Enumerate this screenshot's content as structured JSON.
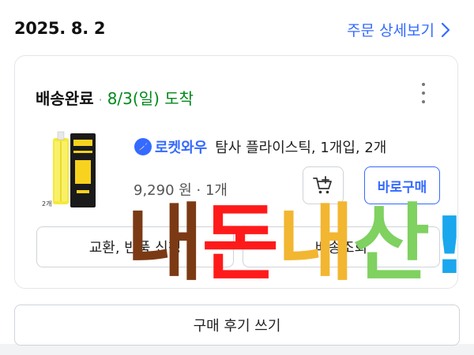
{
  "order": {
    "date": "2025. 8. 2",
    "detail_link": "주문 상세보기"
  },
  "shipment": {
    "status": "배송완료",
    "separator": "·",
    "arrival": "8/3(일) 도착"
  },
  "product": {
    "rocket_badge": "로켓와우",
    "name": "탐사 플라이스틱, 1개입, 2개",
    "price_qty": "9,290 원 · 1개",
    "thumb_label": "2개"
  },
  "buttons": {
    "buy_again": "바로구매",
    "return_exchange": "교환, 반품 신청",
    "track_shipment": "배송조회",
    "write_review": "구매 후기 쓰기"
  },
  "overlay": {
    "chars": [
      "내",
      "돈",
      "내",
      "산",
      "!"
    ],
    "colors": [
      "#7b3a14",
      "#ff1a1a",
      "#f2b630",
      "#7fd160",
      "#1aa7ee"
    ]
  },
  "colors": {
    "accent": "#346aff",
    "arrival": "#00891a"
  }
}
